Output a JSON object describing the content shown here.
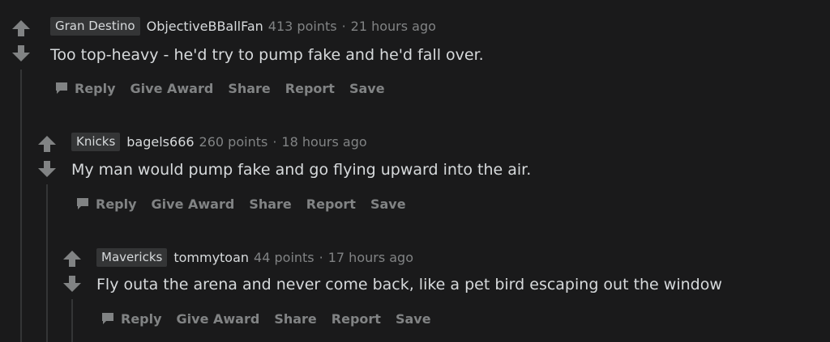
{
  "comments": [
    {
      "flair": "Gran Destino",
      "author": "ObjectiveBBallFan",
      "points": "413 points",
      "separator": "·",
      "time": "21 hours ago",
      "body": "Too top-heavy - he'd try to pump fake and he'd fall over."
    },
    {
      "flair": "Knicks",
      "author": "bagels666",
      "points": "260 points",
      "separator": "·",
      "time": "18 hours ago",
      "body": "My man would pump fake and go flying upward into the air."
    },
    {
      "flair": "Mavericks",
      "author": "tommytoan",
      "points": "44 points",
      "separator": "·",
      "time": "17 hours ago",
      "body": "Fly outa the arena and never come back, like a pet bird escaping out the window"
    }
  ],
  "actions": {
    "reply": "Reply",
    "give_award": "Give Award",
    "share": "Share",
    "report": "Report",
    "save": "Save"
  },
  "icons": {
    "upvote": "upvote-arrow-icon",
    "downvote": "downvote-arrow-icon",
    "reply": "comment-bubble-icon"
  },
  "colors": {
    "background": "#1a1a1b",
    "text": "#d7dadc",
    "muted": "#818384",
    "flair_bg": "#343536",
    "arrow": "#818384"
  }
}
